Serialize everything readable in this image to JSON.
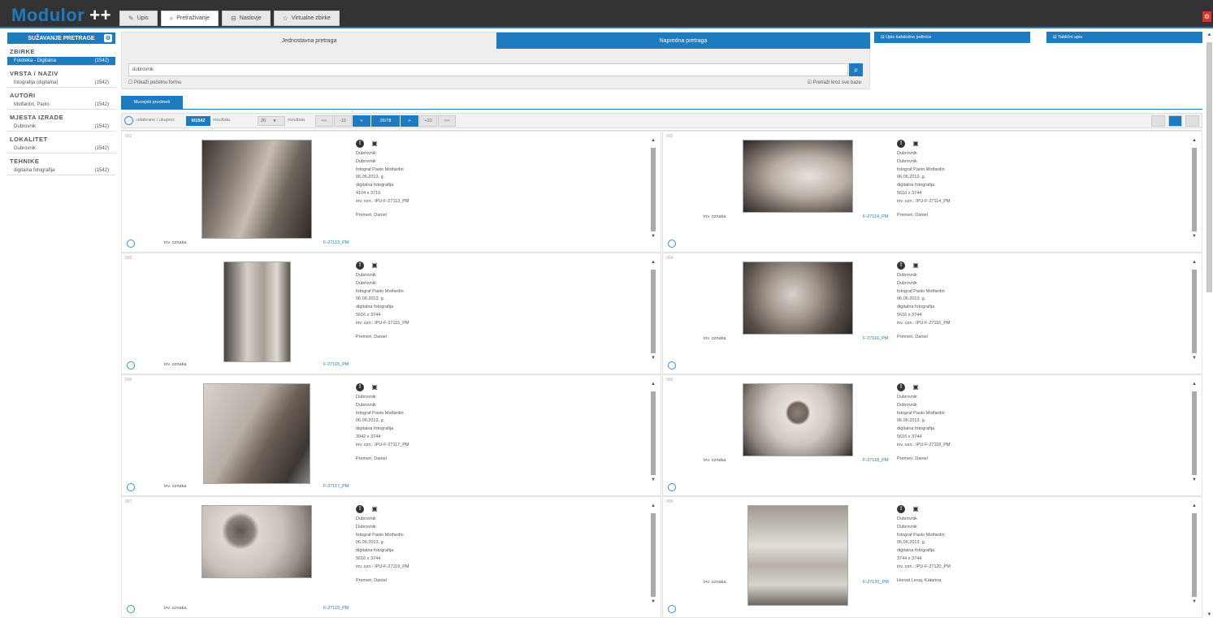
{
  "app": {
    "logo": "Modulor",
    "logo_plus": "++"
  },
  "tabs": [
    {
      "icon": "✎",
      "label": "Upis"
    },
    {
      "icon": "⌕",
      "label": "Pretraživanje"
    },
    {
      "icon": "⊟",
      "label": "Naslovje"
    },
    {
      "icon": "☆",
      "label": "Virtualne zbirke"
    }
  ],
  "sidebar": {
    "header": "SUŽAVANJE PRETRAGE",
    "sections": [
      {
        "title": "ZBIRKE",
        "rows": [
          {
            "label": "Fototeka - Digitalna",
            "count": "(1542)",
            "active": true
          }
        ]
      },
      {
        "title": "VRSTA / NAZIV",
        "rows": [
          {
            "label": "fotografija (digitalna)",
            "count": "(1542)"
          }
        ]
      },
      {
        "title": "AUTORI",
        "rows": [
          {
            "label": "Motfardin, Paolo",
            "count": "(1542)"
          }
        ]
      },
      {
        "title": "MJESTA IZRADE",
        "rows": [
          {
            "label": "Dubrovnik",
            "count": "(1542)"
          }
        ]
      },
      {
        "title": "LOKALITET",
        "rows": [
          {
            "label": "Dubrovnik",
            "count": "(1542)"
          }
        ]
      },
      {
        "title": "TEHNIKE",
        "rows": [
          {
            "label": "digitalna fotografija",
            "count": "(1542)"
          }
        ]
      }
    ]
  },
  "search": {
    "tab_simple": "Jednostavna pretraga",
    "tab_advanced": "Napredna pretraga",
    "value": "dubrovnik",
    "check_form": "Prikaži početnu formu",
    "check_all": "Pretraži kroz sve baze",
    "btn_catalog": "Upis katalošne jedinice",
    "btn_table": "Tablični upis"
  },
  "section_tab": "Muzejski predmeti",
  "pager": {
    "label": "odabrano / ukupno:",
    "count": "0/1542",
    "rezultata": "rezultata",
    "per_page": "20",
    "rezultata2": "rezultata",
    "buttons": [
      "<<",
      "-10",
      "<",
      "26/78",
      ">",
      "+10",
      ">>"
    ]
  },
  "cards": [
    {
      "num": "001",
      "lines": [
        "Dubrovnik",
        "Dubrovnik",
        "fotograf Paolo Motfardin",
        "06.06.2013. g.",
        "digitalna fotografija",
        "4104 x 3716",
        "inv. ozn.: IPU-F-27113_PM"
      ],
      "person": "Premeri, Daniel",
      "inv_label": "inv. oznaka",
      "inv": "F-27113_PM"
    },
    {
      "num": "002",
      "lines": [
        "Dubrovnik",
        "Dubrovnik",
        "fotograf Paolo Motfardin",
        "06.06.2013. g.",
        "digitalna fotografija",
        "5616 x 3744",
        "inv. ozn.: IPU-F-27114_PM"
      ],
      "person": "Premeri, Daniel",
      "inv_label": "inv. oznaka",
      "inv": "F-27114_PM"
    },
    {
      "num": "003",
      "lines": [
        "Dubrovnik",
        "Dubrovnik",
        "fotograf Paolo Motfardin",
        "06.06.2013. g.",
        "digitalna fotografija",
        "5616 x 3744",
        "inv. ozn.: IPU-F-27115_PM"
      ],
      "person": "Premeri, Daniel",
      "inv_label": "inv. oznaka",
      "inv": "F-27115_PM"
    },
    {
      "num": "004",
      "lines": [
        "Dubrovnik",
        "Dubrovnik",
        "fotograf Paolo Motfardin",
        "06.06.2013. g.",
        "digitalna fotografija",
        "5616 x 3744",
        "inv. ozn.: IPU-F-27116_PM"
      ],
      "person": "Premeri, Daniel",
      "inv_label": "inv. oznaka",
      "inv": "F-27116_PM"
    },
    {
      "num": "005",
      "lines": [
        "Dubrovnik",
        "Dubrovnik",
        "fotograf Paolo Motfardin",
        "06.06.2013. g.",
        "digitalna fotografija",
        "3942 x 3744",
        "inv. ozn.: IPU-F-27117_PM"
      ],
      "person": "Premeri, Daniel",
      "inv_label": "inv. oznaka",
      "inv": "F-27117_PM"
    },
    {
      "num": "006",
      "lines": [
        "Dubrovnik",
        "Dubrovnik",
        "fotograf Paolo Motfardin",
        "06.06.2013. g.",
        "digitalna fotografija",
        "5616 x 3744",
        "inv. ozn.: IPU-F-27118_PM"
      ],
      "person": "Premeri, Daniel",
      "inv_label": "inv. oznaka",
      "inv": "F-27118_PM"
    },
    {
      "num": "007",
      "lines": [
        "Dubrovnik",
        "Dubrovnik",
        "fotograf Paolo Motfardin",
        "06.06.2013. g.",
        "digitalna fotografija",
        "5616 x 3744",
        "inv. ozn.: IPU-F-27119_PM"
      ],
      "person": "Premeri, Daniel",
      "inv_label": "inv. oznaka",
      "inv": "F-27119_PM"
    },
    {
      "num": "008",
      "lines": [
        "Dubrovnik",
        "Dubrovnik",
        "fotograf Paolo Motfardin",
        "06.06.2013. g.",
        "digitalna fotografija",
        "3744 x 3744",
        "inv. ozn.: IPU-F-27120_PM"
      ],
      "person": "Horvat Levaj, Katarina",
      "inv_label": "inv. oznaka",
      "inv": "F-27120_PM"
    }
  ]
}
